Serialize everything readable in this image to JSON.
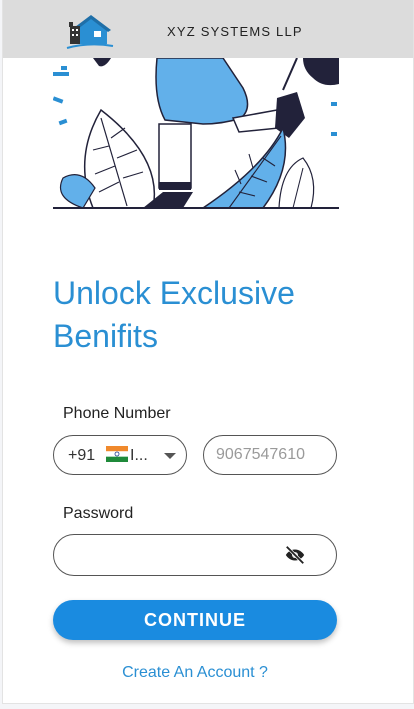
{
  "header": {
    "brand": "XYZ SYSTEMS LLP",
    "logo_icon": "house-icon"
  },
  "colors": {
    "accent": "#2a8fd3",
    "button": "#1a8be0",
    "topbar": "#dcdcdc"
  },
  "main": {
    "heading": "Unlock Exclusive Benifits"
  },
  "form": {
    "phone_label": "Phone Number",
    "country_code": "+91",
    "country_flag": "india-flag",
    "country_name": "I...",
    "phone_placeholder": "9067547610",
    "phone_value": "",
    "password_label": "Password",
    "password_value": "",
    "password_toggle_icon": "eye-off-icon",
    "continue_label": "CONTINUE",
    "create_account_label": "Create An Account ?"
  }
}
